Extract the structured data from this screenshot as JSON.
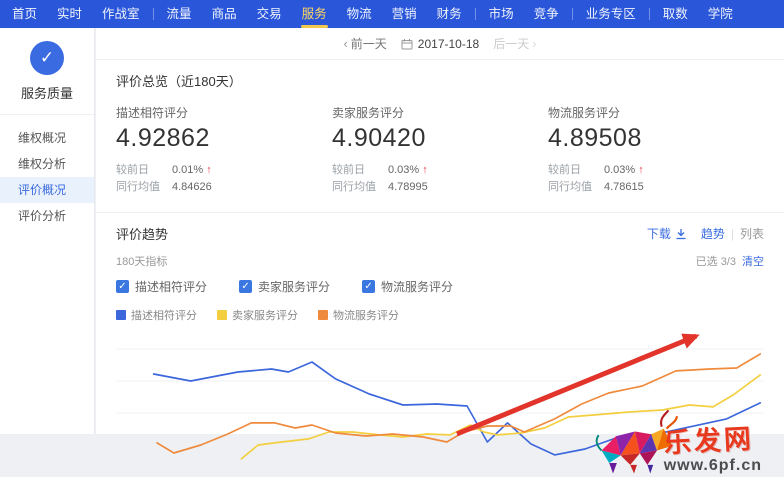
{
  "nav": {
    "items": [
      {
        "label": "首页"
      },
      {
        "label": "实时"
      },
      {
        "label": "作战室"
      },
      {
        "label": "流量"
      },
      {
        "label": "商品"
      },
      {
        "label": "交易"
      },
      {
        "label": "服务"
      },
      {
        "label": "物流"
      },
      {
        "label": "营销"
      },
      {
        "label": "财务"
      },
      {
        "label": "市场"
      },
      {
        "label": "竞争"
      },
      {
        "label": "业务专区"
      },
      {
        "label": "取数"
      },
      {
        "label": "学院"
      }
    ],
    "active_label": "服务"
  },
  "sidebar": {
    "icon": "check-badge-icon",
    "title": "服务质量",
    "items": [
      {
        "label": "维权概况"
      },
      {
        "label": "维权分析"
      },
      {
        "label": "评价概况"
      },
      {
        "label": "评价分析"
      }
    ],
    "active_label": "评价概况"
  },
  "datebar": {
    "prev": "前一天",
    "date": "2017-10-18",
    "next": "后一天"
  },
  "overview": {
    "title": "评价总览（近180天）",
    "metrics": [
      {
        "label": "描述相符评分",
        "value": "4.92862",
        "compare_label": "较前日",
        "compare_value": "0.01%",
        "trend": "up",
        "peer_label": "同行均值",
        "peer_value": "4.84626"
      },
      {
        "label": "卖家服务评分",
        "value": "4.90420",
        "compare_label": "较前日",
        "compare_value": "0.03%",
        "trend": "up",
        "peer_label": "同行均值",
        "peer_value": "4.78995"
      },
      {
        "label": "物流服务评分",
        "value": "4.89508",
        "compare_label": "较前日",
        "compare_value": "0.03%",
        "trend": "up",
        "peer_label": "同行均值",
        "peer_value": "4.78615"
      }
    ]
  },
  "trend": {
    "title": "评价趋势",
    "download_label": "下载",
    "view_trend": "趋势",
    "view_list": "列表",
    "filter_label": "180天指标",
    "selected_info": "已选 3/3",
    "clear_label": "清空",
    "legend": [
      {
        "label": "描述相符评分",
        "color": "#3b66dc",
        "checked": true
      },
      {
        "label": "卖家服务评分",
        "color": "#f3cf3f",
        "checked": true
      },
      {
        "label": "物流服务评分",
        "color": "#ef8a3c",
        "checked": true
      }
    ]
  },
  "watermark": {
    "brand": "乐发网",
    "url": "www.6pf.cn"
  },
  "chart_data": {
    "type": "line",
    "title": "评价趋势（近180天）",
    "x_unit": "day_index_0_to_180",
    "x_axis_labels_visible": false,
    "y_axis_labels_visible": false,
    "grid": true,
    "y_gridline_scores": [
      4.94,
      4.92,
      4.9,
      4.88
    ],
    "legend_position": "top-left",
    "series": [
      {
        "name": "描述相符评分",
        "color": "#3b66dc",
        "points": [
          [
            0,
            4.9244
          ],
          [
            11,
            4.92
          ],
          [
            25,
            4.9256
          ],
          [
            35,
            4.9275
          ],
          [
            40,
            4.9256
          ],
          [
            47,
            4.9319
          ],
          [
            54,
            4.9213
          ],
          [
            64,
            4.9119
          ],
          [
            74,
            4.905
          ],
          [
            84,
            4.9056
          ],
          [
            93,
            4.9044
          ],
          [
            99,
            4.8819
          ],
          [
            105,
            4.8938
          ],
          [
            112,
            4.8806
          ],
          [
            119,
            4.8738
          ],
          [
            128,
            4.8775
          ],
          [
            138,
            4.885
          ],
          [
            148,
            4.8863
          ],
          [
            159,
            4.8913
          ],
          [
            170,
            4.8963
          ],
          [
            180,
            4.9063
          ]
        ]
      },
      {
        "name": "卖家服务评分",
        "color": "#f3cf3f",
        "points": [
          [
            26,
            4.8713
          ],
          [
            31,
            4.88
          ],
          [
            38,
            4.8819
          ],
          [
            46,
            4.8838
          ],
          [
            52,
            4.8881
          ],
          [
            59,
            4.8881
          ],
          [
            67,
            4.8863
          ],
          [
            74,
            4.885
          ],
          [
            81,
            4.8869
          ],
          [
            88,
            4.8863
          ],
          [
            94,
            4.8925
          ],
          [
            98,
            4.8881
          ],
          [
            102,
            4.8863
          ],
          [
            109,
            4.8875
          ],
          [
            116,
            4.8906
          ],
          [
            123,
            4.8975
          ],
          [
            131,
            4.8988
          ],
          [
            141,
            4.9006
          ],
          [
            151,
            4.9019
          ],
          [
            159,
            4.905
          ],
          [
            166,
            4.9038
          ],
          [
            172,
            4.9113
          ],
          [
            180,
            4.9238
          ]
        ]
      },
      {
        "name": "物流服务评分",
        "color": "#ef8a3c",
        "points": [
          [
            1,
            4.8813
          ],
          [
            6,
            4.875
          ],
          [
            14,
            4.88
          ],
          [
            22,
            4.8869
          ],
          [
            29,
            4.8938
          ],
          [
            36,
            4.8938
          ],
          [
            42,
            4.8906
          ],
          [
            47,
            4.8925
          ],
          [
            54,
            4.8875
          ],
          [
            63,
            4.8856
          ],
          [
            71,
            4.8869
          ],
          [
            80,
            4.885
          ],
          [
            87,
            4.8819
          ],
          [
            92,
            4.8881
          ],
          [
            99,
            4.8919
          ],
          [
            106,
            4.8919
          ],
          [
            110,
            4.8881
          ],
          [
            119,
            4.8963
          ],
          [
            127,
            4.9056
          ],
          [
            135,
            4.9125
          ],
          [
            145,
            4.9169
          ],
          [
            155,
            4.9263
          ],
          [
            165,
            4.9275
          ],
          [
            173,
            4.9281
          ],
          [
            180,
            4.9369
          ]
        ]
      }
    ],
    "annotation_arrow": {
      "from": [
        90,
        4.8869
      ],
      "to": [
        161,
        4.9481
      ],
      "color": "#e2342b",
      "meaning": "upward trend emphasis"
    }
  }
}
